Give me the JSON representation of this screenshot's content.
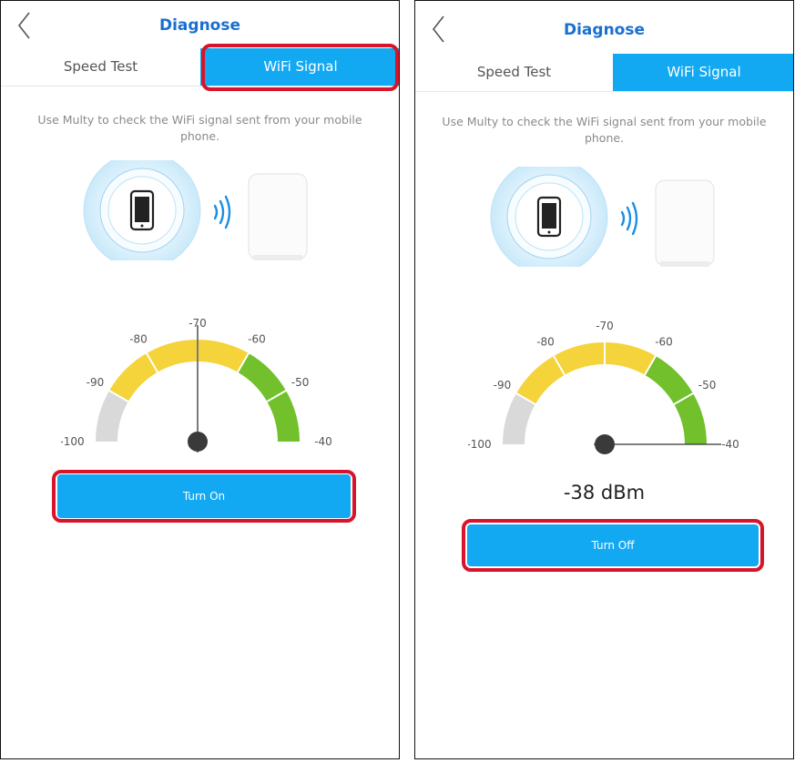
{
  "screens": [
    {
      "header": {
        "title": "Diagnose"
      },
      "tabs": [
        {
          "label": "Speed Test",
          "active": false
        },
        {
          "label": "WiFi Signal",
          "active": true
        }
      ],
      "description": "Use Multy to check the WiFi signal sent from your mobile phone.",
      "gauge": {
        "ticks": [
          "-100",
          "-90",
          "-80",
          "-70",
          "-60",
          "-50",
          "-40"
        ],
        "needle_value_dbm": -70
      },
      "button_label": "Turn On",
      "highlights": [
        "wifi-signal-tab",
        "turn-on-button"
      ]
    },
    {
      "header": {
        "title": "Diagnose"
      },
      "tabs": [
        {
          "label": "Speed Test",
          "active": false
        },
        {
          "label": "WiFi Signal",
          "active": true
        }
      ],
      "description": "Use Multy to check the WiFi signal sent from your mobile phone.",
      "gauge": {
        "ticks": [
          "-100",
          "-90",
          "-80",
          "-70",
          "-60",
          "-50",
          "-40"
        ],
        "needle_value_dbm": -38
      },
      "reading": "-38 dBm",
      "button_label": "Turn Off",
      "highlights": [
        "turn-off-button"
      ]
    }
  ],
  "colors": {
    "accent": "#12a9f2",
    "title": "#1a6fd0",
    "highlight": "#d8142a",
    "gauge_gray": "#d9d9d9",
    "gauge_yellow": "#f5d33a",
    "gauge_green": "#72c02c"
  }
}
